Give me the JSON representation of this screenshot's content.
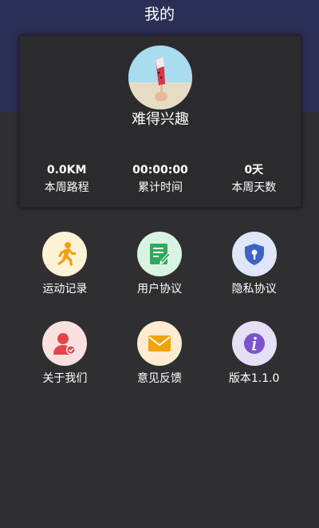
{
  "header": {
    "title": "我的"
  },
  "profile": {
    "username": "难得兴趣"
  },
  "stats": [
    {
      "value": "0.0KM",
      "label": "本周路程"
    },
    {
      "value": "00:00:00",
      "label": "累计时间"
    },
    {
      "value": "0天",
      "label": "本周天数"
    }
  ],
  "menu": [
    {
      "label": "运动记录",
      "icon": "running-icon"
    },
    {
      "label": "用户协议",
      "icon": "document-edit-icon"
    },
    {
      "label": "隐私协议",
      "icon": "shield-key-icon"
    },
    {
      "label": "关于我们",
      "icon": "user-check-icon"
    },
    {
      "label": "意见反馈",
      "icon": "mail-icon"
    },
    {
      "label": "版本1.1.0",
      "icon": "info-icon"
    }
  ]
}
